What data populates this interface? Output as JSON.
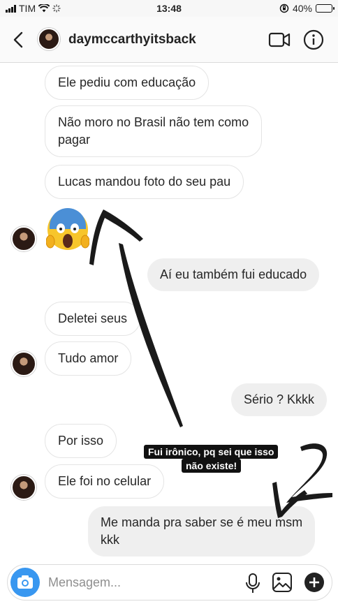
{
  "status_bar": {
    "carrier": "TIM",
    "time": "13:48",
    "battery_text": "40%",
    "battery_level": 0.4
  },
  "header": {
    "username": "daymccarthyitsback",
    "icons": [
      "chevron-left-icon",
      "video-camera-icon",
      "info-icon"
    ]
  },
  "messages": [
    {
      "side": "in",
      "text": "Ele pediu com educação"
    },
    {
      "side": "in",
      "lines": [
        "Não moro no Brasil não tem como",
        "pagar"
      ]
    },
    {
      "side": "in",
      "text": "Lucas mandou foto do seu pau"
    },
    {
      "side": "in",
      "emoji": "screaming-face"
    },
    {
      "side": "out",
      "text": "Aí eu também fui educado"
    },
    {
      "side": "in",
      "text": "Deletei seus"
    },
    {
      "side": "in",
      "text": "Tudo amor"
    },
    {
      "side": "out",
      "text": "Sério ? Kkkk"
    },
    {
      "side": "in",
      "text": "Por isso"
    },
    {
      "side": "in",
      "text": "Ele foi no celular"
    },
    {
      "side": "out",
      "lines": [
        "Me manda pra saber se é meu msm",
        "kkk"
      ]
    }
  ],
  "story_caption": {
    "lines": [
      "Fui irônico, pq sei que isso",
      "não existe!"
    ]
  },
  "composer": {
    "placeholder": "Mensagem...",
    "icons": [
      "camera-icon",
      "microphone-icon",
      "gallery-icon",
      "plus-icon"
    ]
  },
  "colors": {
    "accent": "#3897f0",
    "outgoing_bubble": "#efefef",
    "incoming_border": "#e4e4e4"
  }
}
